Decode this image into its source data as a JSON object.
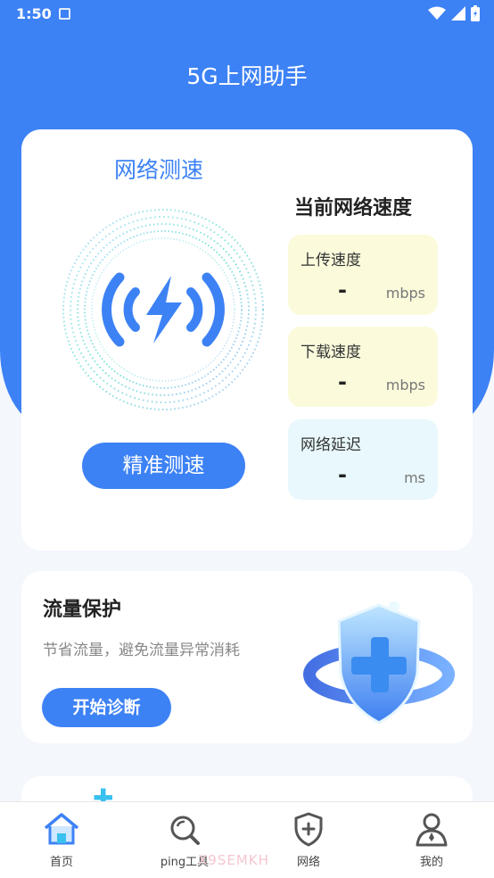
{
  "status_bar": {
    "time": "1:50"
  },
  "app": {
    "title": "5G上网助手"
  },
  "speed_card": {
    "title": "网络测速",
    "button": "精准测速",
    "current_title": "当前网络速度",
    "upload": {
      "label": "上传速度",
      "value": "-",
      "unit": "mbps"
    },
    "download": {
      "label": "下载速度",
      "value": "-",
      "unit": "mbps"
    },
    "latency": {
      "label": "网络延迟",
      "value": "-",
      "unit": "ms"
    }
  },
  "protection_card": {
    "title": "流量保护",
    "description": "节省流量，避免流量异常消耗",
    "button": "开始诊断"
  },
  "bottom_nav": [
    {
      "label": "首页",
      "icon": "home-icon"
    },
    {
      "label": "ping工具",
      "icon": "search-icon"
    },
    {
      "label": "网络",
      "icon": "shield-plus-icon"
    },
    {
      "label": "我的",
      "icon": "user-icon"
    }
  ],
  "watermark": "X9SEMKH",
  "colors": {
    "accent": "#3d82f5",
    "upload_bg": "#fbfbdc",
    "latency_bg": "#e8f8fc"
  }
}
